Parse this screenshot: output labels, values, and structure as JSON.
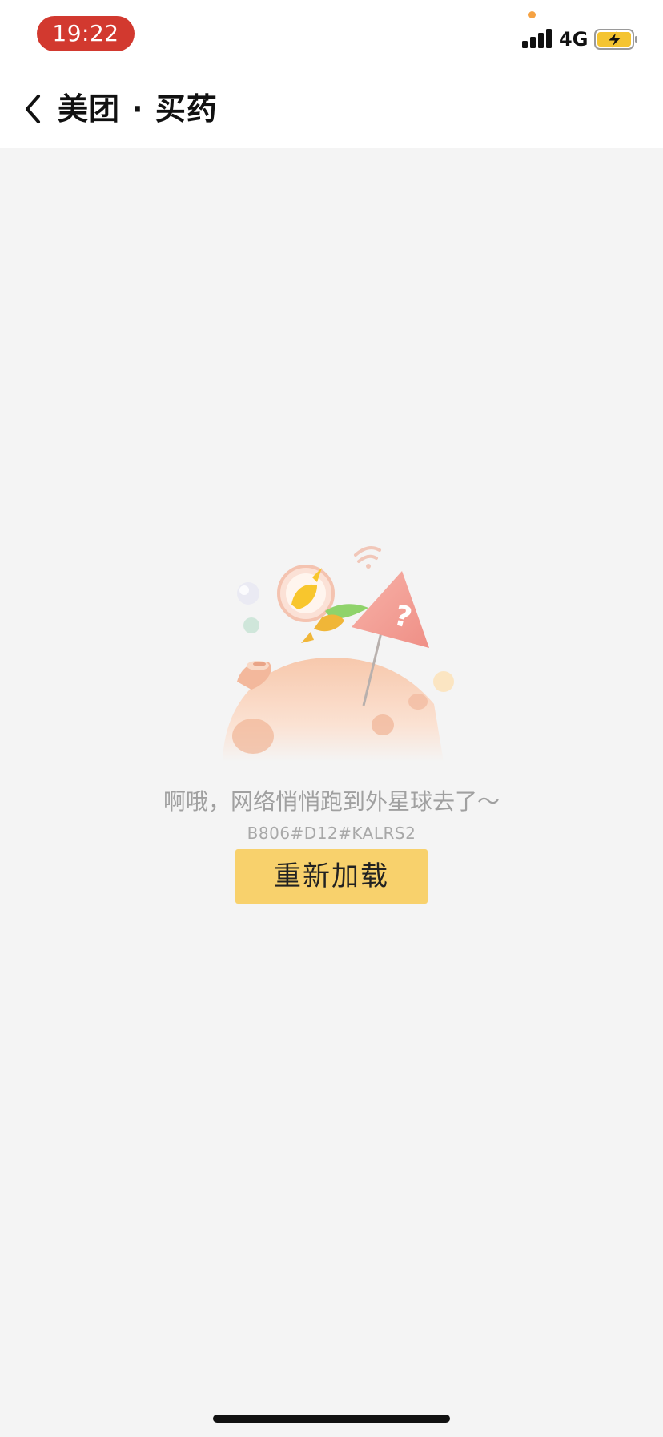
{
  "status_bar": {
    "time": "19:22",
    "network_type": "4G",
    "colors": {
      "time_pill": "#d2392f",
      "privacy_dot": "#f5a243",
      "battery_fill": "#f4c431"
    },
    "icons": [
      "signal-icon",
      "battery-charging-icon"
    ]
  },
  "nav": {
    "back_icon": "chevron-left-icon",
    "title": "美团 · 买药"
  },
  "error": {
    "illustration": "astronaut-kangaroo-on-planet-illustration",
    "message": "啊哦，网络悄悄跑到外星球去了～",
    "code": "B806#D12#KALRS2",
    "reload_label": "重新加载"
  },
  "theme": {
    "background": "#f4f4f4",
    "accent": "#f8d16c"
  }
}
